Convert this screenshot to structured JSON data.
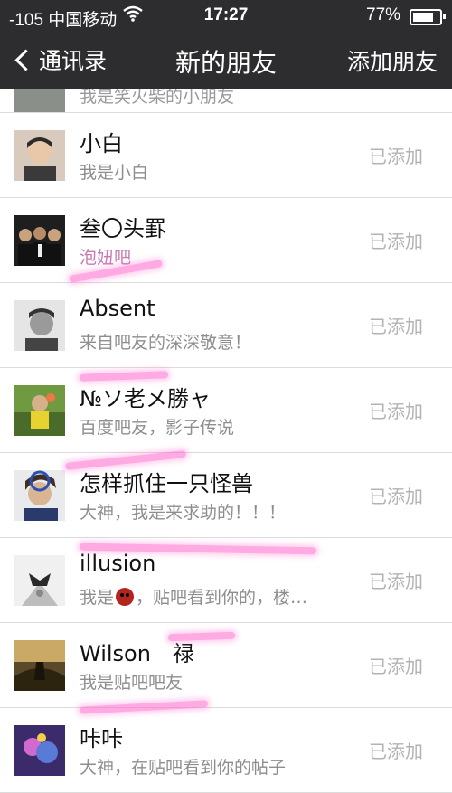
{
  "status_bar": {
    "signal": "-105 中国移动",
    "wifi_icon": "wifi-icon",
    "time": "17:27",
    "battery": "77%",
    "battery_level": 0.77
  },
  "nav": {
    "back_label": "通讯录",
    "title": "新的朋友",
    "add_label": "添加朋友"
  },
  "partial_row": {
    "subtitle": "我是笑火柴的小朋友"
  },
  "rows": [
    {
      "name": "小白",
      "subtitle": "我是小白",
      "status": "已添加",
      "avatar_color": "#c9b7a6"
    },
    {
      "name": "叁〇头罫",
      "subtitle": "泡妞吧",
      "status": "已添加",
      "avatar_color": "#2a2a2a"
    },
    {
      "name": "Absent",
      "subtitle": "来自吧友的深深敬意！",
      "status": "已添加",
      "avatar_color": "#bfbfbf"
    },
    {
      "name": "№ソ老メ勝ャ",
      "subtitle": "百度吧友，影子传说",
      "status": "已添加",
      "avatar_color": "#6e8a3a"
    },
    {
      "name": "怎样抓住一只怪兽",
      "subtitle": "大神，我是来求助的！！！",
      "status": "已添加",
      "avatar_color": "#7a8b95"
    },
    {
      "name": "illusion",
      "subtitle_a": "我是",
      "subtitle_b": "，贴吧看到你的，楼…",
      "status": "已添加",
      "avatar_color": "#d9d9d9"
    },
    {
      "name": "Wilson　禄",
      "subtitle": "我是贴吧吧友",
      "status": "已添加",
      "avatar_color": "#7b6a46"
    },
    {
      "name": "咔咔",
      "subtitle": "大神，在贴吧看到你的帖子",
      "status": "已添加",
      "avatar_color": "#4b3d7a"
    }
  ],
  "colors": {
    "navbar": "#2d2d2f",
    "highlight": "#ff66cc",
    "status_text": "#b3b3b3"
  }
}
